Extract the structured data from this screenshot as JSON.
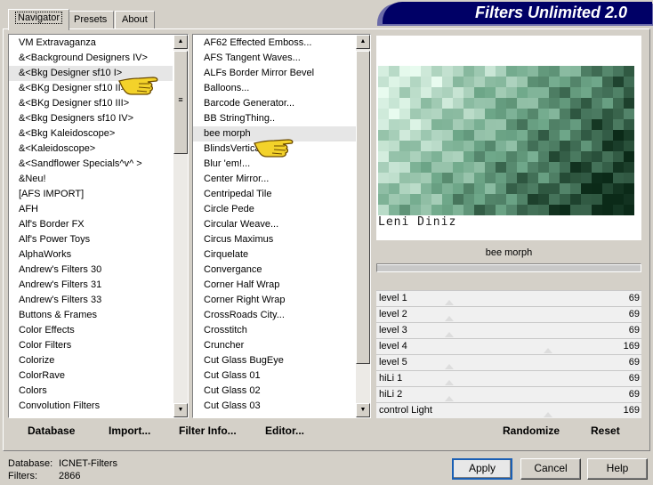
{
  "tabs": [
    {
      "label": "Navigator",
      "active": true
    },
    {
      "label": "Presets",
      "active": false
    },
    {
      "label": "About",
      "active": false
    }
  ],
  "banner": {
    "title": "Filters Unlimited 2.0"
  },
  "categories": {
    "selected": "&<Bkg Designer sf10 I>",
    "items": [
      "VM Extravaganza",
      "&<Background Designers IV>",
      "&<Bkg Designer sf10 I>",
      "&<BKg Designer sf10 II>",
      "&<BKg Designer sf10 III>",
      "&<Bkg Designers sf10 IV>",
      "&<Bkg Kaleidoscope>",
      "&<Kaleidoscope>",
      "&<Sandflower Specials^v^ >",
      "&Neu!",
      "[AFS IMPORT]",
      "AFH",
      "Alf's Border FX",
      "Alf's Power Toys",
      "AlphaWorks",
      "Andrew's Filters 30",
      "Andrew's Filters 31",
      "Andrew's Filters 33",
      "Buttons & Frames",
      "Color Effects",
      "Color Filters",
      "Colorize",
      "ColorRave",
      "Colors",
      "Convolution Filters"
    ]
  },
  "filters": {
    "selected": "bee morph",
    "items": [
      "AF62 Effected Emboss...",
      "AFS Tangent Waves...",
      "ALFs Border Mirror Bevel",
      "Balloons...",
      "Barcode Generator...",
      "BB StringThing..",
      "bee morph",
      "BlindsVertical",
      "Blur 'em!...",
      "Center Mirror...",
      "Centripedal Tile",
      "Circle Pede",
      "Circular Weave...",
      "Circus Maximus",
      "Cirquelate",
      "Convergance",
      "Corner Half Wrap",
      "Corner Right Wrap",
      "CrossRoads City...",
      "Crosstitch",
      "Cruncher",
      "Cut Glass  BugEye",
      "Cut Glass 01",
      "Cut Glass 02",
      "Cut Glass 03"
    ]
  },
  "preview": {
    "watermark": "Leni Diniz",
    "colors": {
      "light": "#e8fbef",
      "mid": "#6fa88a",
      "dark": "#0b2a18"
    }
  },
  "current_filter": {
    "name": "bee morph",
    "progress": 1.0
  },
  "params": [
    {
      "label": "level 1",
      "value": "69"
    },
    {
      "label": "level 2",
      "value": "69"
    },
    {
      "label": "level 3",
      "value": "69"
    },
    {
      "label": "level 4",
      "value": "169"
    },
    {
      "label": "level 5",
      "value": "69"
    },
    {
      "label": "hiLi 1",
      "value": "69"
    },
    {
      "label": "hiLi 2",
      "value": "69"
    },
    {
      "label": "control Light",
      "value": "169"
    }
  ],
  "toolbar": {
    "database": "Database",
    "import": "Import...",
    "filter_info": "Filter Info...",
    "editor": "Editor...",
    "randomize": "Randomize",
    "reset": "Reset"
  },
  "status": {
    "database_label": "Database:",
    "database_value": "ICNET-Filters",
    "filters_label": "Filters:",
    "filters_value": "2866"
  },
  "buttons": {
    "apply": "Apply",
    "cancel": "Cancel",
    "help": "Help"
  },
  "icons": {
    "pointer": "pointing-hand-icon",
    "scroll_up": "scroll-up-icon",
    "scroll_down": "scroll-down-icon"
  }
}
